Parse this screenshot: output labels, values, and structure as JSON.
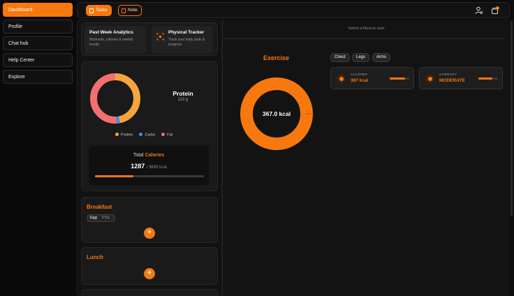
{
  "sidebar": {
    "items": [
      {
        "label": "Dashboard"
      },
      {
        "label": "Profile"
      },
      {
        "label": "Chat hub"
      },
      {
        "label": "Help Center"
      },
      {
        "label": "Explore"
      }
    ]
  },
  "topbar": {
    "tasks_label": "Tasks",
    "note_label": "Note",
    "notification_count": "1"
  },
  "cards": {
    "analytics": {
      "title": "Past Week Analytics",
      "subtitle": "Workouts, calories & weekly trends"
    },
    "tracker": {
      "title": "Physical Tracker",
      "subtitle": "Track your body stats & progress"
    }
  },
  "macros": {
    "selected_name": "Protein",
    "selected_value": "113 g",
    "legend": [
      "Protein",
      "Carbs",
      "Fat"
    ],
    "colors": {
      "protein": "#f7a53b",
      "carbs": "#3b8ff7",
      "fat": "#f47070"
    },
    "shares": {
      "protein": 0.47,
      "carbs": 0.02,
      "fat": 0.51
    }
  },
  "calories": {
    "label": "Total",
    "label_accent": "Calories",
    "current": "1287",
    "total": "/ 3685 kcal",
    "progress": 0.35
  },
  "meals": {
    "breakfast": {
      "title": "Breakfast",
      "item": "Egg",
      "grams": "300g"
    },
    "lunch": {
      "title": "Lunch"
    },
    "add_symbol": "+"
  },
  "exercise": {
    "hint": "Select a Meal to start",
    "title": "Exercise",
    "ring_value": "367.0 kcal",
    "tags": [
      "Chest",
      "Legs",
      "Arms"
    ],
    "stats": [
      {
        "label": "CALORIES",
        "value": "367 kcal",
        "level": 0.8
      },
      {
        "label": "INTENSITY",
        "value": "MODERATE",
        "level": 0.7
      }
    ]
  },
  "accent": "#f7780f"
}
